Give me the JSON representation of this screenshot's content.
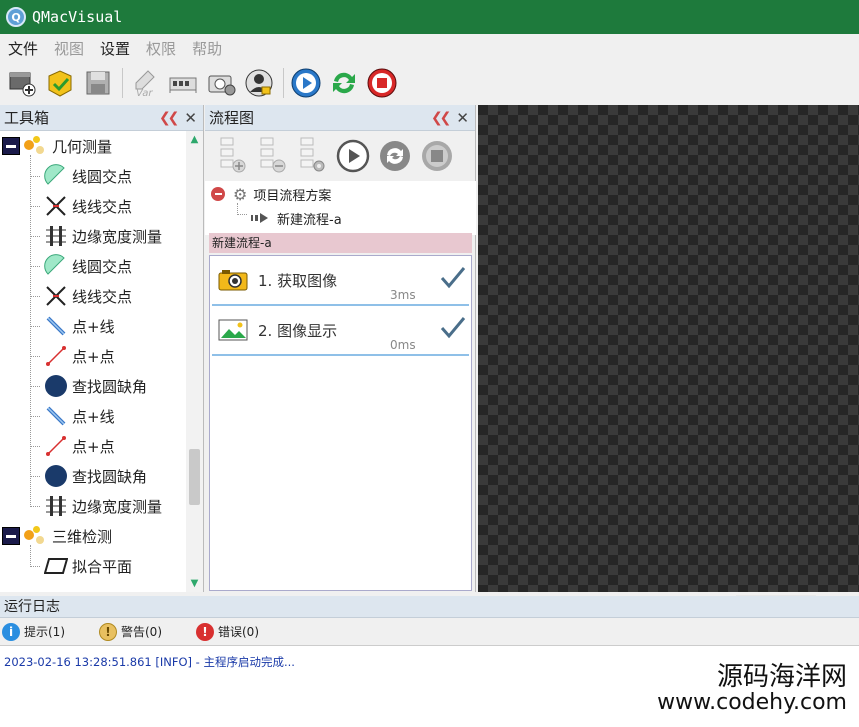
{
  "window": {
    "title": "QMacVisual"
  },
  "menu": [
    {
      "label": "文件",
      "active": true
    },
    {
      "label": "视图",
      "active": false
    },
    {
      "label": "设置",
      "active": true
    },
    {
      "label": "权限",
      "active": false
    },
    {
      "label": "帮助",
      "active": false
    }
  ],
  "toolbar": {
    "buttons": [
      "new-project-icon",
      "open-project-icon",
      "save-icon",
      "variable-icon",
      "io-card-icon",
      "camera-settings-icon",
      "user-login-icon",
      "run-once-icon",
      "run-loop-icon",
      "stop-icon"
    ]
  },
  "toolbox": {
    "title": "工具箱",
    "groups": [
      {
        "label": "几何测量",
        "items": [
          {
            "label": "线圆交点",
            "icon": "circle-line-intersect-icon"
          },
          {
            "label": "线线交点",
            "icon": "line-cross-icon"
          },
          {
            "label": "边缘宽度测量",
            "icon": "edge-width-icon"
          },
          {
            "label": "线圆交点",
            "icon": "circle-line-intersect-icon"
          },
          {
            "label": "线线交点",
            "icon": "line-cross-icon"
          },
          {
            "label": "点+线",
            "icon": "point-line-icon"
          },
          {
            "label": "点+点",
            "icon": "point-point-icon"
          },
          {
            "label": "查找圆缺角",
            "icon": "circle-notch-icon"
          },
          {
            "label": "点+线",
            "icon": "point-line-icon"
          },
          {
            "label": "点+点",
            "icon": "point-point-icon"
          },
          {
            "label": "查找圆缺角",
            "icon": "circle-notch-icon"
          },
          {
            "label": "边缘宽度测量",
            "icon": "edge-width-icon"
          }
        ]
      },
      {
        "label": "三维检测",
        "items": [
          {
            "label": "拟合平面",
            "icon": "fit-plane-icon"
          }
        ]
      }
    ]
  },
  "flow": {
    "title": "流程图",
    "project_label": "项目流程方案",
    "flow_label": "新建流程-a",
    "selected_flow": "新建流程-a",
    "steps": [
      {
        "label": "1. 获取图像",
        "time": "3ms",
        "icon": "camera-icon",
        "ok": true
      },
      {
        "label": "2. 图像显示",
        "time": "0ms",
        "icon": "image-icon",
        "ok": true
      }
    ]
  },
  "log": {
    "title": "运行日志",
    "filters": [
      {
        "label": "提示(1)",
        "color": "#2a8ee0",
        "symbol": "i"
      },
      {
        "label": "警告(0)",
        "color": "#e8c060",
        "symbol": "!"
      },
      {
        "label": "错误(0)",
        "color": "#d83030",
        "symbol": "!"
      }
    ],
    "entries": [
      "2023-02-16 13:28:51.861 [INFO]  -  主程序启动完成..."
    ]
  },
  "watermark": {
    "line1": "源码海洋网",
    "line2": "www.codehy.com"
  },
  "colors": {
    "titlebar": "#1e7a3c",
    "panel_header": "#dde6ef",
    "selection": "#e8c8d0"
  }
}
